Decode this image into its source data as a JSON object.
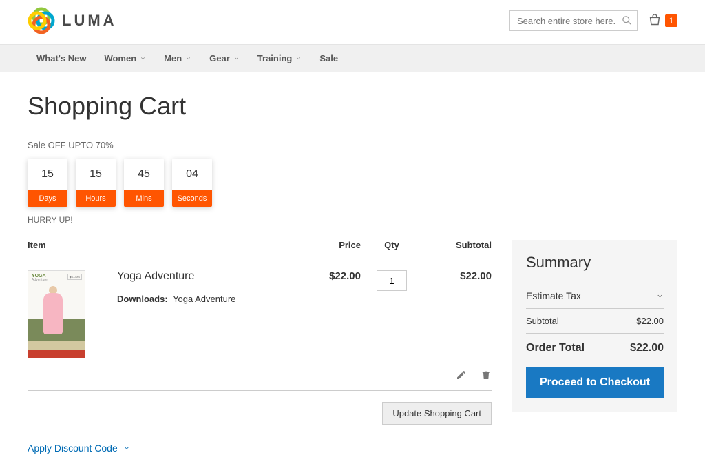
{
  "header": {
    "brand": "LUMA",
    "search_placeholder": "Search entire store here...",
    "cart_count": "1"
  },
  "nav": {
    "items": [
      {
        "label": "What's New",
        "has_children": false
      },
      {
        "label": "Women",
        "has_children": true
      },
      {
        "label": "Men",
        "has_children": true
      },
      {
        "label": "Gear",
        "has_children": true
      },
      {
        "label": "Training",
        "has_children": true
      },
      {
        "label": "Sale",
        "has_children": false
      }
    ]
  },
  "page": {
    "title": "Shopping Cart",
    "sale_label": "Sale OFF UPTO 70%",
    "hurry": "HURRY UP!",
    "countdown": [
      {
        "value": "15",
        "unit": "Days"
      },
      {
        "value": "15",
        "unit": "Hours"
      },
      {
        "value": "45",
        "unit": "Mins"
      },
      {
        "value": "04",
        "unit": "Seconds"
      }
    ]
  },
  "cart": {
    "columns": {
      "item": "Item",
      "price": "Price",
      "qty": "Qty",
      "subtotal": "Subtotal"
    },
    "items": [
      {
        "name": "Yoga Adventure",
        "downloads_label": "Downloads:",
        "downloads_value": "Yoga Adventure",
        "price": "$22.00",
        "qty": "1",
        "subtotal": "$22.00",
        "thumb_title": "YOGA",
        "thumb_sub": "Adventure"
      }
    ],
    "update_label": "Update Shopping Cart",
    "discount_label": "Apply Discount Code"
  },
  "summary": {
    "title": "Summary",
    "estimate_label": "Estimate Tax",
    "subtotal_label": "Subtotal",
    "subtotal_value": "$22.00",
    "total_label": "Order Total",
    "total_value": "$22.00",
    "checkout_label": "Proceed to Checkout"
  }
}
